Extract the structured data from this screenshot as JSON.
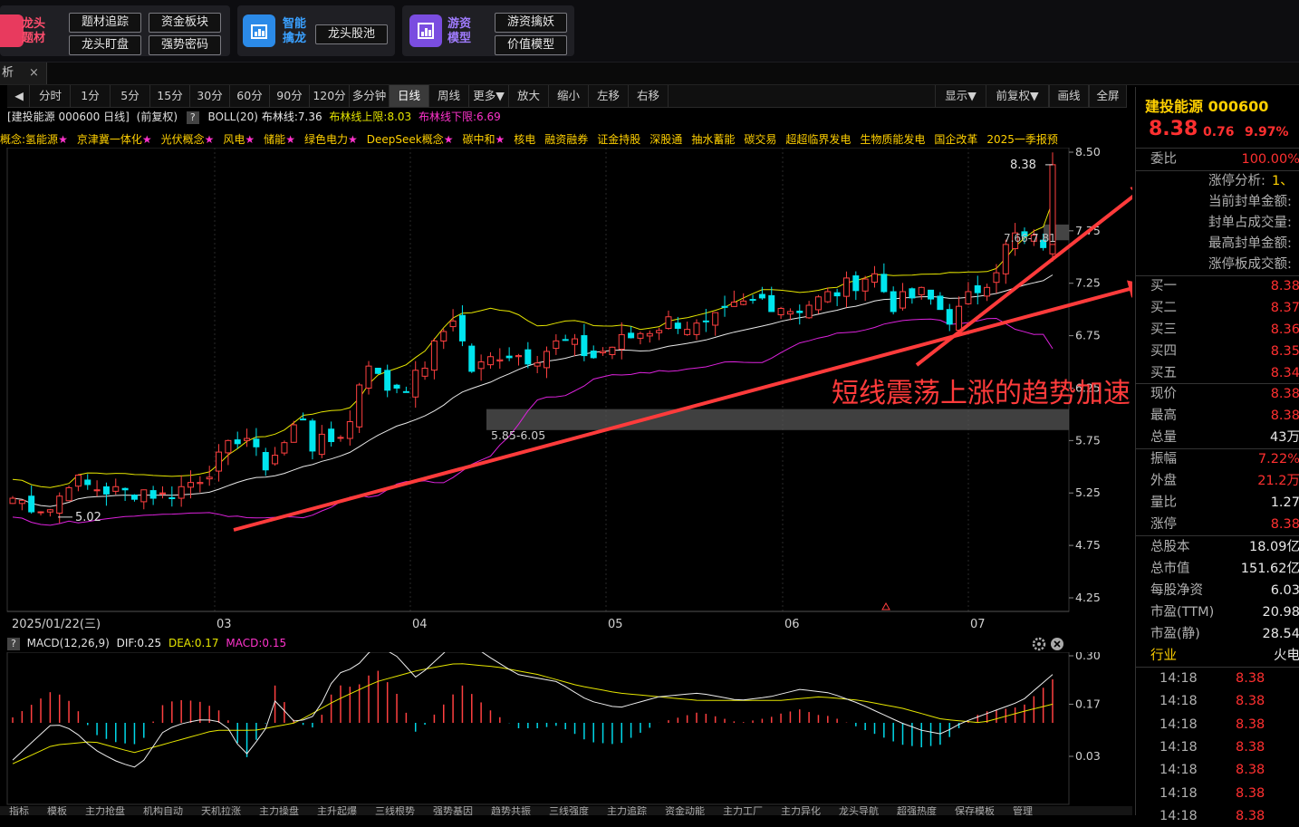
{
  "banner": {
    "group1": {
      "title_line1": "龙头",
      "title_line2": "题材",
      "buttons": [
        "题材追踪",
        "资金板块",
        "龙头盯盘",
        "强势密码"
      ]
    },
    "group2": {
      "title_line1": "智能",
      "title_line2": "擒龙",
      "buttons": [
        "龙头股池"
      ]
    },
    "group3": {
      "title_line1": "游资",
      "title_line2": "模型",
      "buttons": [
        "游资擒妖",
        "价值模型"
      ]
    }
  },
  "tabs": {
    "first_label": "析",
    "close": "×"
  },
  "toolbar": {
    "back": "◀",
    "periods": [
      "分时",
      "1分",
      "5分",
      "15分",
      "30分",
      "60分",
      "90分",
      "120分",
      "多分钟",
      "日线",
      "周线",
      "更多▼",
      "放大",
      "缩小",
      "左移",
      "右移"
    ],
    "active": "日线",
    "right": [
      "显示▼",
      "前复权▼",
      "画线",
      "全屏"
    ]
  },
  "chart_header": {
    "stock": "[建投能源 000600 日线]",
    "adjust": "(前复权)",
    "help": "?",
    "indicator": "BOLL(20)",
    "boll_mid": "布林线:7.36",
    "boll_up": "布林线上限:8.03",
    "boll_down": "布林线下限:6.69"
  },
  "concepts_prefix": "概念:",
  "concepts": [
    {
      "name": "氢能源",
      "star": true
    },
    {
      "name": "京津冀一体化",
      "star": true
    },
    {
      "name": "光伏概念",
      "star": true
    },
    {
      "name": "风电",
      "star": true
    },
    {
      "name": "储能",
      "star": true
    },
    {
      "name": "绿色电力",
      "star": true
    },
    {
      "name": "DeepSeek概念",
      "star": true
    },
    {
      "name": "碳中和",
      "star": true
    },
    {
      "name": "核电",
      "star": false
    },
    {
      "name": "融资融券",
      "star": false
    },
    {
      "name": "证金持股",
      "star": false
    },
    {
      "name": "深股通",
      "star": false
    },
    {
      "name": "抽水蓄能",
      "star": false
    },
    {
      "name": "碳交易",
      "star": false
    },
    {
      "name": "超超临界发电",
      "star": false
    },
    {
      "name": "生物质能发电",
      "star": false
    },
    {
      "name": "国企改革",
      "star": false
    },
    {
      "name": "2025一季报预",
      "star": false
    }
  ],
  "chart_data": {
    "type": "candlestick",
    "y_ticks": [
      "8.50",
      "7.75",
      "7.25",
      "6.75",
      "6.25",
      "5.75",
      "5.25",
      "4.75",
      "4.25"
    ],
    "y_tick_values": [
      8.5,
      7.75,
      7.25,
      6.75,
      6.25,
      5.75,
      5.25,
      4.75,
      4.25
    ],
    "x_labels": [
      "2025/01/22(三)",
      "03",
      "04",
      "05",
      "06",
      "07"
    ],
    "annotations": {
      "high_label": "8.38",
      "low_label": "5.02",
      "zone_label": "5.85-6.05",
      "upper_zone_label": "7.66-7.81",
      "text": "短线震荡上涨的趋势加速"
    },
    "macd": {
      "header": "MACD(12,26,9)",
      "dif": "DIF:0.25",
      "dea": "DEA:0.17",
      "macd": "MACD:0.15",
      "y_ticks": [
        "0.30",
        "0.17",
        "0.03"
      ],
      "y_tick_values": [
        0.3,
        0.17,
        0.03
      ]
    }
  },
  "quote": {
    "name": "建投能源 000600",
    "price": "8.38",
    "change": "0.76",
    "pct": "9.97%",
    "weibi_label": "委比",
    "weibi": "100.00%",
    "limit_lines": [
      "涨停分析:",
      "当前封单金额:",
      "封单占成交量:",
      "最高封单金额:",
      "涨停板成交额:"
    ],
    "limit_extra": "1、",
    "book": [
      {
        "label": "买一",
        "value": "8.38"
      },
      {
        "label": "买二",
        "value": "8.37"
      },
      {
        "label": "买三",
        "value": "8.36"
      },
      {
        "label": "买四",
        "value": "8.35"
      },
      {
        "label": "买五",
        "value": "8.34"
      }
    ],
    "stats": [
      {
        "label": "现价",
        "value": "8.38",
        "color": "red"
      },
      {
        "label": "最高",
        "value": "8.38",
        "color": "red"
      },
      {
        "label": "总量",
        "value": "43万",
        "color": "white"
      },
      {
        "label": "振幅",
        "value": "7.22%",
        "color": "red"
      },
      {
        "label": "外盘",
        "value": "21.2万",
        "color": "red"
      },
      {
        "label": "量比",
        "value": "1.27",
        "color": "white"
      },
      {
        "label": "涨停",
        "value": "8.38",
        "color": "red"
      }
    ],
    "fundamentals": [
      {
        "label": "总股本",
        "value": "18.09亿"
      },
      {
        "label": "总市值",
        "value": "151.62亿"
      },
      {
        "label": "每股净资",
        "value": "6.03"
      },
      {
        "label": "市盈(TTM)",
        "value": "20.98"
      },
      {
        "label": "市盈(静)",
        "value": "28.54"
      },
      {
        "label": "行业",
        "value": "火电"
      }
    ],
    "ticks": [
      {
        "time": "14:18",
        "price": "8.38"
      },
      {
        "time": "14:18",
        "price": "8.38"
      },
      {
        "time": "14:18",
        "price": "8.38"
      },
      {
        "time": "14:18",
        "price": "8.38"
      },
      {
        "time": "14:18",
        "price": "8.38"
      },
      {
        "time": "14:18",
        "price": "8.38"
      },
      {
        "time": "14:18",
        "price": "8.38"
      }
    ]
  },
  "bottom_tabs": [
    "指标",
    "模板",
    "主力抢盘",
    "机构自动",
    "天机拉涨",
    "主力操盘",
    "主升起爆",
    "三线根势",
    "强势基因",
    "趋势共振",
    "三线强度",
    "主力追踪",
    "资金动能",
    "主力工厂",
    "主力异化",
    "龙头导航",
    "超强热度",
    "保存模板",
    "管理"
  ]
}
